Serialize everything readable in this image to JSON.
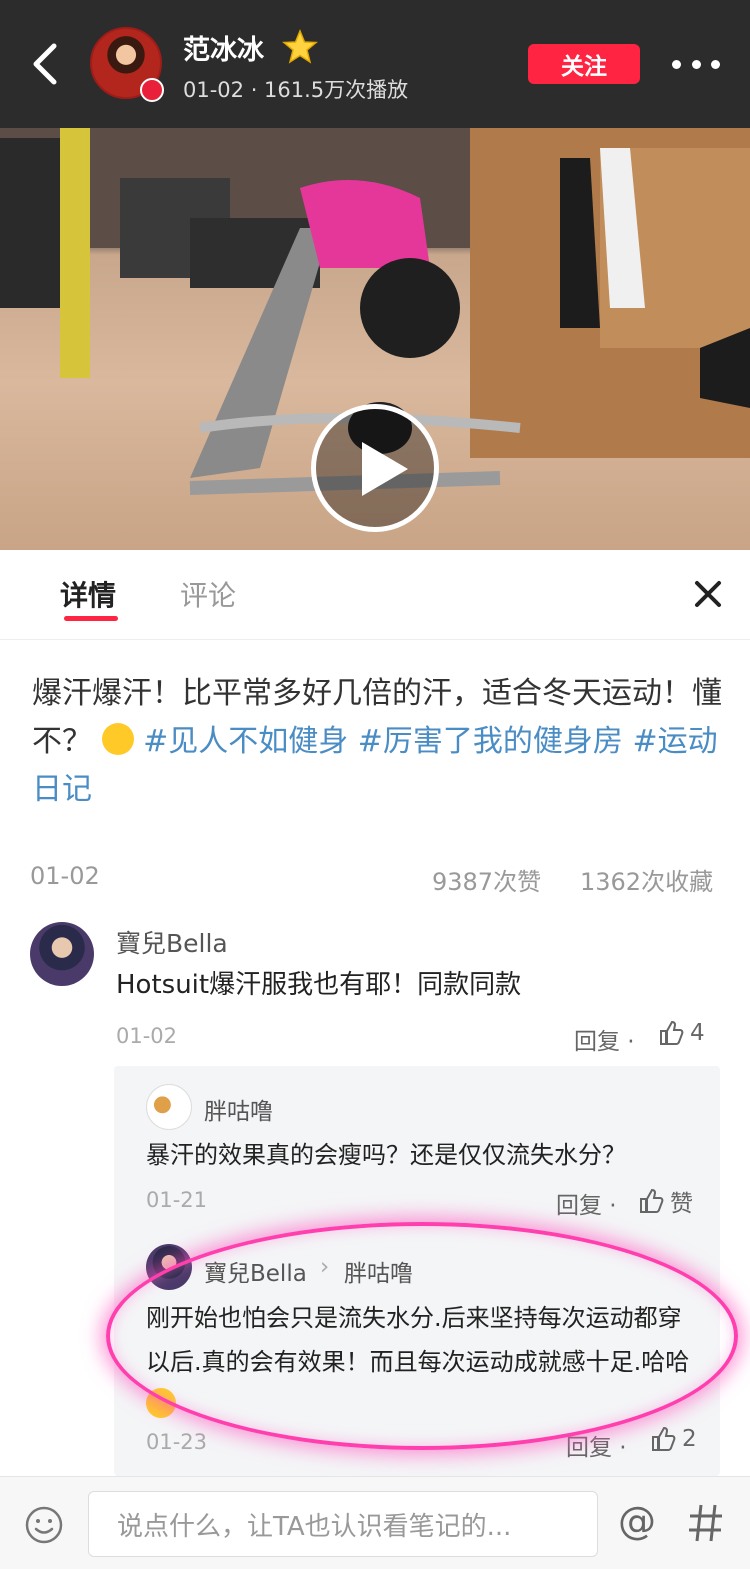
{
  "header": {
    "author": "范冰冰",
    "meta": "01-02 · 161.5万次播放",
    "follow_label": "关注"
  },
  "tabs": [
    {
      "label": "详情"
    },
    {
      "label": "评论"
    }
  ],
  "post": {
    "text_plain": "爆汗爆汗！比平常多好几倍的汗，适合冬天运动！懂不？",
    "hashtags": [
      "#见人不如健身",
      "#厉害了我的健身房",
      "#运动日记"
    ],
    "date": "01-02",
    "likes": "9387次赞",
    "favorites": "1362次收藏"
  },
  "comments": [
    {
      "user": "寶兒Bella",
      "text": "Hotsuit爆汗服我也有耶！同款同款",
      "date": "01-02",
      "reply_label": "回复 ·",
      "likes": "4",
      "replies": [
        {
          "user": "胖咕噜",
          "text": "暴汗的效果真的会瘦吗？还是仅仅流失水分？",
          "date": "01-21",
          "reply_label": "回复 ·",
          "likes": "赞"
        },
        {
          "user": "寶兒Bella",
          "reply_to": "胖咕噜",
          "text": "刚开始也怕会只是流失水分.后来坚持每次运动都穿以后.真的会有效果！而且每次运动成就感十足.哈哈",
          "date": "01-23",
          "reply_label": "回复 ·",
          "likes": "2"
        }
      ]
    }
  ],
  "input": {
    "placeholder": "说点什么，让TA也认识看笔记的..."
  },
  "colors": {
    "brand_red": "#ff2442",
    "hashtag_blue": "#4a8cc4",
    "highlight_pink": "#ff3fae"
  },
  "icons": [
    "back-icon",
    "star-icon",
    "more-icon",
    "play-icon",
    "close-icon",
    "thumb-up-icon",
    "emoji-icon",
    "at-icon",
    "hash-icon"
  ]
}
